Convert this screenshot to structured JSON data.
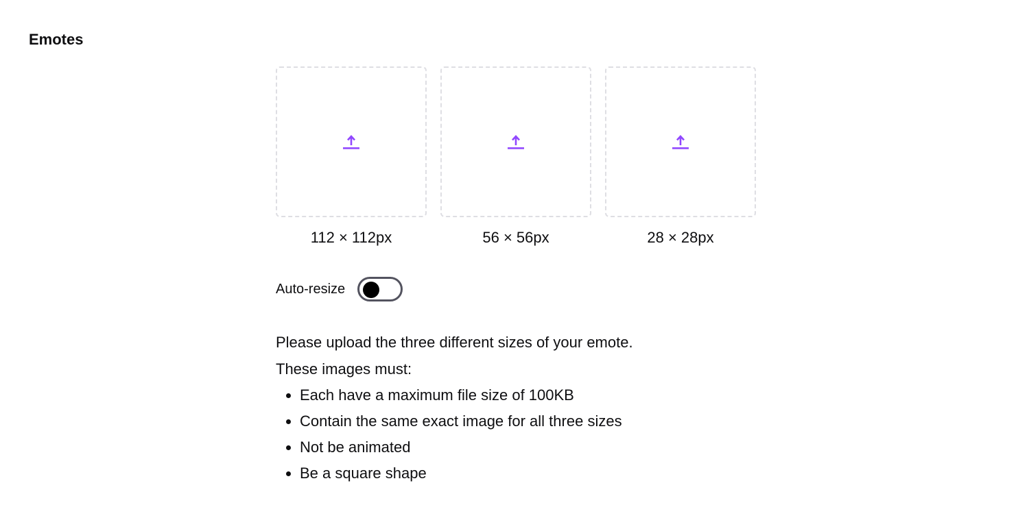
{
  "section": {
    "title": "Emotes"
  },
  "uploads": [
    {
      "label": "112 × 112px",
      "icon": "upload-icon"
    },
    {
      "label": "56 × 56px",
      "icon": "upload-icon"
    },
    {
      "label": "28 × 28px",
      "icon": "upload-icon"
    }
  ],
  "auto_resize": {
    "label": "Auto-resize",
    "enabled": false
  },
  "instructions": {
    "line1": "Please upload the three different sizes of your emote.",
    "line2": "These images must:",
    "requirements": [
      "Each have a maximum file size of 100KB",
      "Contain the same exact image for all three sizes",
      "Not be animated",
      "Be a square shape"
    ]
  },
  "colors": {
    "accent": "#9147ff",
    "dashed_border": "#dedee3",
    "toggle_border": "#53535f",
    "text": "#0e0e10"
  }
}
